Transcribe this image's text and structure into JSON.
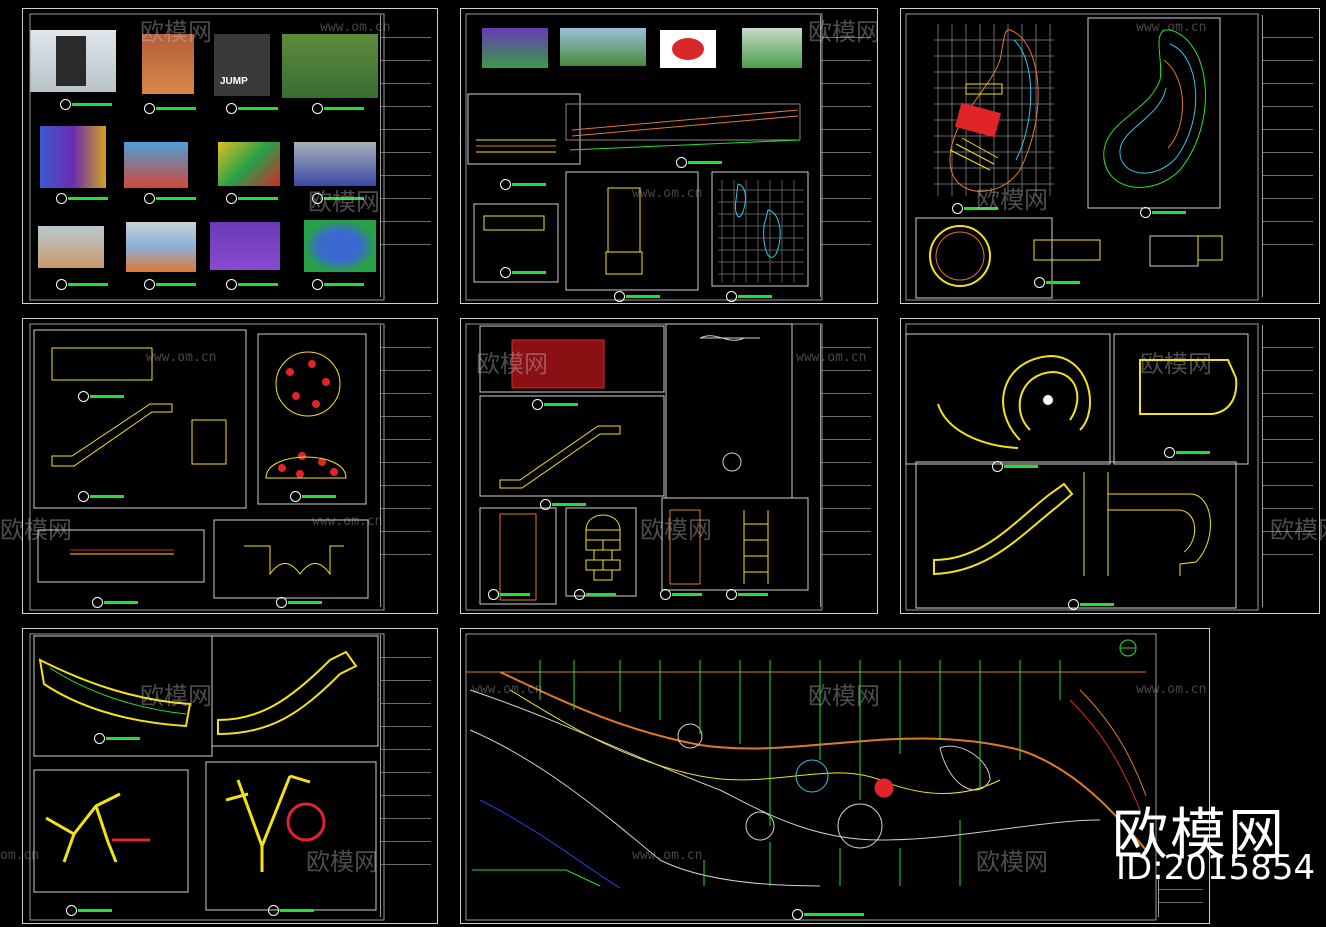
{
  "watermark": {
    "text": "欧模网",
    "url": "www.om.cn",
    "url_short": "om.cn"
  },
  "brand": {
    "name": "欧模网",
    "id": "ID:2015854"
  },
  "colors": {
    "background": "#000000",
    "frame": "#cfcfcf",
    "dim_green": "#22e12b",
    "yellow": "#f4e312",
    "cyan": "#2ec7e6",
    "red": "#e0242a",
    "orange": "#e07a22"
  },
  "sheets": [
    {
      "id": "reference-photos"
    },
    {
      "id": "paving-sections"
    },
    {
      "id": "bean-play-area"
    },
    {
      "id": "slide-details"
    },
    {
      "id": "net-slide-details"
    },
    {
      "id": "spiral-slide"
    },
    {
      "id": "curved-slide-frame"
    },
    {
      "id": "site-plan"
    }
  ]
}
